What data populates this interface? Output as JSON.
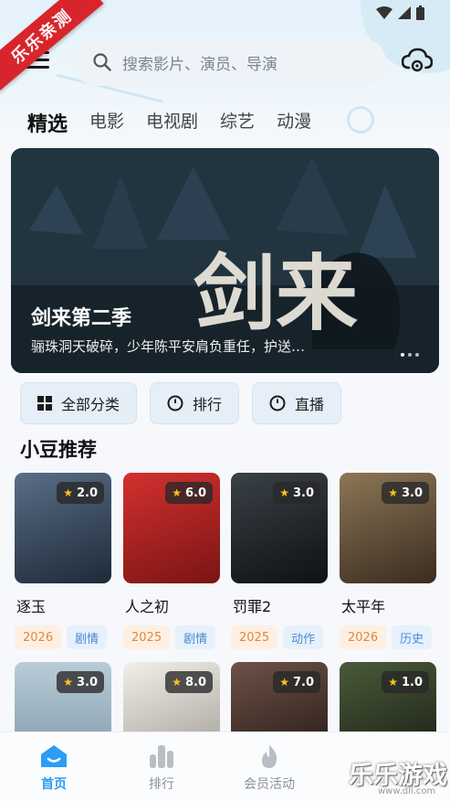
{
  "ribbon": {
    "text": "乐乐亲测"
  },
  "search": {
    "placeholder": "搜索影片、演员、导演"
  },
  "tabs": [
    {
      "label": "精选",
      "active": true
    },
    {
      "label": "电影",
      "active": false
    },
    {
      "label": "电视剧",
      "active": false
    },
    {
      "label": "综艺",
      "active": false
    },
    {
      "label": "动漫",
      "active": false
    }
  ],
  "banner": {
    "title": "剑来第二季",
    "subtitle": "骊珠洞天破碎，少年陈平安肩负重任，护送…",
    "calligraphy": "剑来",
    "dots": 3
  },
  "quick_actions": [
    {
      "label": "全部分类",
      "icon": "grid-icon"
    },
    {
      "label": "排行",
      "icon": "clock-icon"
    },
    {
      "label": "直播",
      "icon": "clock-icon"
    }
  ],
  "section": {
    "title": "小豆推荐"
  },
  "recommendations": [
    {
      "title": "逐玉",
      "rating": "2.0",
      "year": "2026",
      "genre": "剧情",
      "poster_color": "#2b3a4a"
    },
    {
      "title": "人之初",
      "rating": "6.0",
      "year": "2025",
      "genre": "剧情",
      "poster_color": "#c4262a"
    },
    {
      "title": "罚罪2",
      "rating": "3.0",
      "year": "2025",
      "genre": "动作",
      "poster_color": "#1f2327"
    },
    {
      "title": "太平年",
      "rating": "3.0",
      "year": "2026",
      "genre": "历史",
      "poster_color": "#6b5a46"
    },
    {
      "title": "",
      "rating": "3.0",
      "year": "",
      "genre": "",
      "poster_color": "#9fb6c4"
    },
    {
      "title": "",
      "rating": "8.0",
      "year": "",
      "genre": "",
      "poster_color": "#e9e6e1"
    },
    {
      "title": "",
      "rating": "7.0",
      "year": "",
      "genre": "",
      "poster_color": "#3a2b26"
    },
    {
      "title": "",
      "rating": "1.0",
      "year": "",
      "genre": "",
      "poster_color": "#2f3a2a"
    }
  ],
  "bottom_nav": [
    {
      "label": "首页",
      "icon": "home-icon",
      "active": true
    },
    {
      "label": "排行",
      "icon": "bar-chart-icon",
      "active": false
    },
    {
      "label": "会员活动",
      "icon": "flame-icon",
      "active": false
    }
  ],
  "watermark": {
    "text": "乐乐游戏",
    "url": "www.dll.com"
  },
  "colors": {
    "accent": "#2a9df4",
    "year_tag": "#e0883a",
    "genre_tag": "#4a8ad4",
    "ribbon": "#d8252b"
  }
}
